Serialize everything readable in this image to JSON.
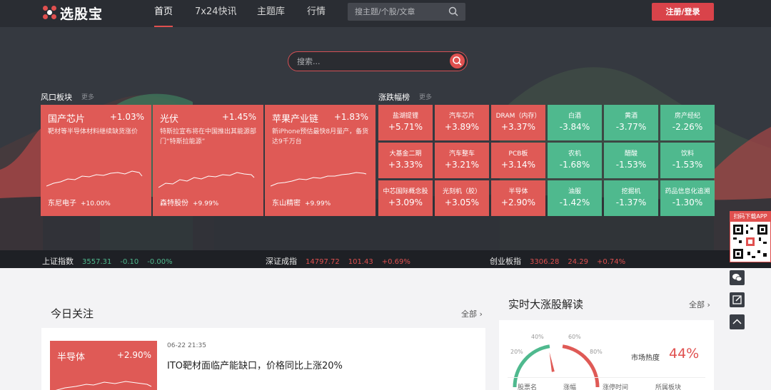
{
  "brand": {
    "name": "选股宝"
  },
  "nav": [
    {
      "label": "首页",
      "active": true
    },
    {
      "label": "7x24快讯",
      "active": false
    },
    {
      "label": "主题库",
      "active": false
    },
    {
      "label": "行情",
      "active": false
    }
  ],
  "top_search": {
    "placeholder": "搜主题/个股/文章",
    "icon": "search-icon"
  },
  "login": {
    "label": "注册/登录"
  },
  "hero_search": {
    "placeholder": "搜索...",
    "icon": "search-icon"
  },
  "sections": {
    "hot": {
      "title": "风口板块",
      "more": "更多"
    },
    "movers": {
      "title": "涨跌幅榜",
      "more": "更多"
    }
  },
  "hot_cards": [
    {
      "name": "国产芯片",
      "pct": "+1.03%",
      "desc": "靶材等半导体材料继续缺货涨价",
      "stock": "东尼电子",
      "stock_pct": "+10.00%"
    },
    {
      "name": "光伏",
      "pct": "+1.45%",
      "desc": "特斯拉宣布将在中国推出其能源部门“特斯拉能源”",
      "stock": "森特股份",
      "stock_pct": "+9.99%"
    },
    {
      "name": "苹果产业链",
      "pct": "+1.83%",
      "desc": "新iPhone预估最快8月量产，备货达9千万台",
      "stock": "东山精密",
      "stock_pct": "+9.99%"
    }
  ],
  "movers": [
    {
      "name": "盐湖提锂",
      "value": "+5.71%",
      "dir": "up"
    },
    {
      "name": "汽车芯片",
      "value": "+3.89%",
      "dir": "up"
    },
    {
      "name": "DRAM（内存）",
      "value": "+3.37%",
      "dir": "up"
    },
    {
      "name": "白酒",
      "value": "-3.84%",
      "dir": "down"
    },
    {
      "name": "黄酒",
      "value": "-3.77%",
      "dir": "down"
    },
    {
      "name": "房产经纪",
      "value": "-2.26%",
      "dir": "down"
    },
    {
      "name": "大基金二期",
      "value": "+3.33%",
      "dir": "up"
    },
    {
      "name": "汽车整车",
      "value": "+3.21%",
      "dir": "up"
    },
    {
      "name": "PCB板",
      "value": "+3.14%",
      "dir": "up"
    },
    {
      "name": "农机",
      "value": "-1.68%",
      "dir": "down"
    },
    {
      "name": "醋酸",
      "value": "-1.53%",
      "dir": "down"
    },
    {
      "name": "饮料",
      "value": "-1.53%",
      "dir": "down"
    },
    {
      "name": "中芯国际概念股",
      "value": "+3.09%",
      "dir": "up"
    },
    {
      "name": "光刻机（胶）",
      "value": "+3.05%",
      "dir": "up"
    },
    {
      "name": "半导体",
      "value": "+2.90%",
      "dir": "up"
    },
    {
      "name": "油服",
      "value": "-1.42%",
      "dir": "down"
    },
    {
      "name": "挖掘机",
      "value": "-1.37%",
      "dir": "down"
    },
    {
      "name": "药品信息化追溯",
      "value": "-1.30%",
      "dir": "down"
    }
  ],
  "indices": [
    {
      "name": "上证指数",
      "value": "3557.31",
      "change": "-0.10",
      "pct": "-0.00%",
      "dir": "down"
    },
    {
      "name": "深证成指",
      "value": "14797.72",
      "change": "101.43",
      "pct": "+0.69%",
      "dir": "up"
    },
    {
      "name": "创业板指",
      "value": "3306.28",
      "change": "24.29",
      "pct": "+0.74%",
      "dir": "up"
    }
  ],
  "app_download": {
    "label": "扫码下载APP"
  },
  "tools": {
    "chat_icon": "chat-icon",
    "edit_icon": "edit-icon",
    "top_icon": "chevron-up-icon"
  },
  "colors": {
    "up": "#df5a56",
    "down": "#4fb98e",
    "accent": "#e0504f"
  },
  "today": {
    "title": "今日关注",
    "all": "全部",
    "card": {
      "name": "半导体",
      "pct": "+2.90%"
    },
    "news_time": "06-22 21:35",
    "news_title": "ITO靶材面临产能缺口，价格同比上涨20%"
  },
  "realtime": {
    "title": "实时大涨股解读",
    "all": "全部",
    "gauge_labels": [
      "20%",
      "40%",
      "60%",
      "80%"
    ],
    "heat_label": "市场热度",
    "heat_value": "44%",
    "heat_level": 0.44,
    "columns": [
      "股票名",
      "涨幅",
      "涨停时间",
      "所属板块"
    ]
  }
}
